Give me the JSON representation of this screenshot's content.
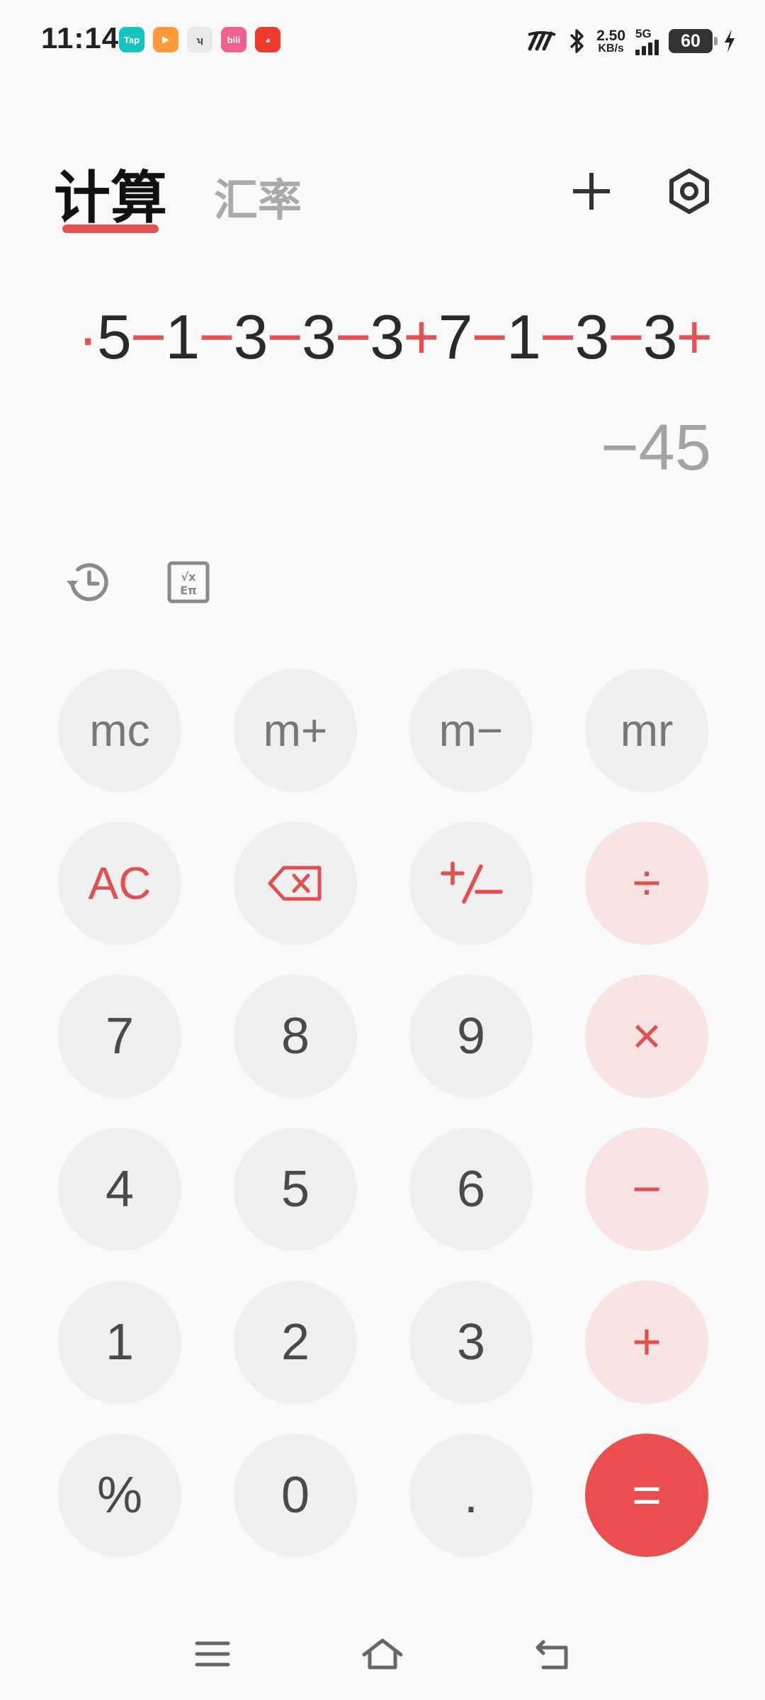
{
  "status_bar": {
    "time": "11:14",
    "apps": [
      {
        "name": "taptap-icon",
        "label": "Tap",
        "color": "#14c4c0"
      },
      {
        "name": "video-app-icon",
        "label": "▶",
        "color": "#ff9a3c"
      },
      {
        "name": "hm-app-icon",
        "label": "ʮ",
        "color": "#e8e8e8"
      },
      {
        "name": "bilibili-icon",
        "label": "bili",
        "color": "#f0608a"
      },
      {
        "name": "mascot-app-icon",
        "label": "◕",
        "color": "#ee3b2f"
      }
    ],
    "speed_value": "2.50",
    "speed_unit": "KB/s",
    "network": "5G",
    "battery": "60"
  },
  "header": {
    "tab_calc": "计算",
    "tab_rate": "汇率"
  },
  "display": {
    "expression_parts": [
      {
        "t": "·",
        "op": true
      },
      {
        "t": "5",
        "op": false
      },
      {
        "t": "−",
        "op": true
      },
      {
        "t": "1",
        "op": false
      },
      {
        "t": "−",
        "op": true
      },
      {
        "t": "3",
        "op": false
      },
      {
        "t": "−",
        "op": true
      },
      {
        "t": "3",
        "op": false
      },
      {
        "t": "−",
        "op": true
      },
      {
        "t": "3",
        "op": false
      },
      {
        "t": "+",
        "op": true
      },
      {
        "t": "7",
        "op": false
      },
      {
        "t": "−",
        "op": true
      },
      {
        "t": "1",
        "op": false
      },
      {
        "t": "−",
        "op": true
      },
      {
        "t": "3",
        "op": false
      },
      {
        "t": "−",
        "op": true
      },
      {
        "t": "3",
        "op": false
      },
      {
        "t": "+",
        "op": true
      }
    ],
    "result": "−45"
  },
  "keys": [
    {
      "label": "mc",
      "name": "memory-clear-button",
      "kind": "mem"
    },
    {
      "label": "m+",
      "name": "memory-add-button",
      "kind": "mem"
    },
    {
      "label": "m−",
      "name": "memory-subtract-button",
      "kind": "mem"
    },
    {
      "label": "mr",
      "name": "memory-recall-button",
      "kind": "mem"
    },
    {
      "label": "AC",
      "name": "all-clear-button",
      "kind": "red ac"
    },
    {
      "label": "",
      "name": "backspace-button",
      "kind": "red",
      "icon": "backspace"
    },
    {
      "label": "+/−",
      "name": "toggle-sign-button",
      "kind": "red",
      "icon": "plusminus"
    },
    {
      "label": "÷",
      "name": "divide-button",
      "kind": "op"
    },
    {
      "label": "7",
      "name": "digit-7-button",
      "kind": "num"
    },
    {
      "label": "8",
      "name": "digit-8-button",
      "kind": "num"
    },
    {
      "label": "9",
      "name": "digit-9-button",
      "kind": "num"
    },
    {
      "label": "×",
      "name": "multiply-button",
      "kind": "op"
    },
    {
      "label": "4",
      "name": "digit-4-button",
      "kind": "num"
    },
    {
      "label": "5",
      "name": "digit-5-button",
      "kind": "num"
    },
    {
      "label": "6",
      "name": "digit-6-button",
      "kind": "num"
    },
    {
      "label": "−",
      "name": "subtract-button",
      "kind": "op"
    },
    {
      "label": "1",
      "name": "digit-1-button",
      "kind": "num"
    },
    {
      "label": "2",
      "name": "digit-2-button",
      "kind": "num"
    },
    {
      "label": "3",
      "name": "digit-3-button",
      "kind": "num"
    },
    {
      "label": "+",
      "name": "add-button",
      "kind": "op"
    },
    {
      "label": "%",
      "name": "percent-button",
      "kind": "num"
    },
    {
      "label": "0",
      "name": "digit-0-button",
      "kind": "num"
    },
    {
      "label": ".",
      "name": "decimal-point-button",
      "kind": "num"
    },
    {
      "label": "=",
      "name": "equals-button",
      "kind": "eq"
    }
  ],
  "colors": {
    "accent": "#e65050",
    "operator_bg": "#f8e3e3",
    "key_bg": "#efefef",
    "equals_bg": "#ea4f4f",
    "result_text": "#a3a3a3"
  }
}
